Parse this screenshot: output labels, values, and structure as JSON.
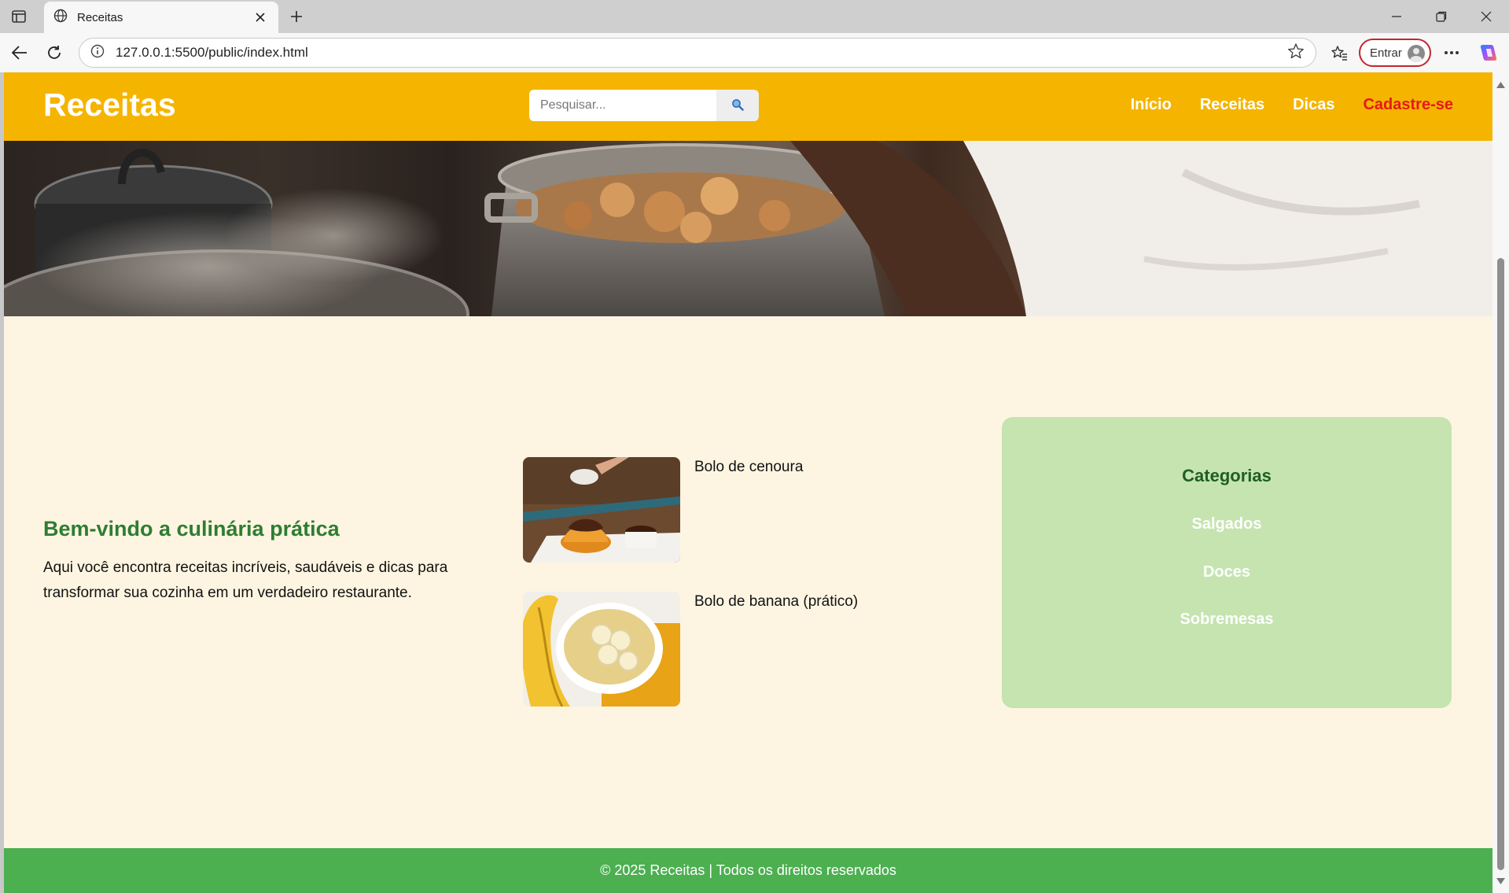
{
  "browser": {
    "tab_title": "Receitas",
    "url": "127.0.0.1:5500/public/index.html",
    "profile_button_label": "Entrar",
    "accent_color": "#c0282d"
  },
  "header": {
    "logo": "Receitas",
    "search_placeholder": "Pesquisar...",
    "search_icon": "magnifier-icon",
    "nav": [
      {
        "label": "Início"
      },
      {
        "label": "Receitas"
      },
      {
        "label": "Dicas"
      },
      {
        "label": "Cadastre-se"
      }
    ],
    "background_color": "#f5b400",
    "signup_color": "#e51a1a"
  },
  "welcome": {
    "title": "Bem-vindo a culinária prática",
    "text": "Aqui você encontra receitas incríveis, saudáveis e dicas para transformar sua cozinha em um verdadeiro restaurante.",
    "title_color": "#2e7d32"
  },
  "recipes": [
    {
      "name": "Bolo de cenoura"
    },
    {
      "name": "Bolo de banana (prático)"
    }
  ],
  "categories": {
    "title": "Categorias",
    "items": [
      "Salgados",
      "Doces",
      "Sobremesas"
    ],
    "background_color": "#c5e4b0"
  },
  "footer": {
    "text": "© 2025 Receitas | Todos os direitos reservados",
    "background_color": "#4caf50"
  }
}
